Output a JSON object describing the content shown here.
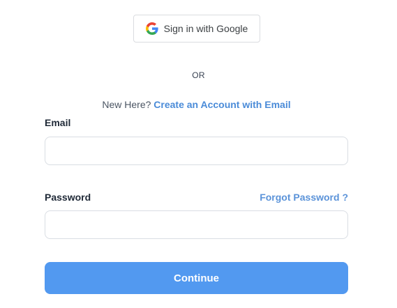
{
  "google_signin": {
    "label": "Sign in with Google",
    "icon": "google-g-icon"
  },
  "divider": {
    "text": "OR"
  },
  "signup_prompt": {
    "prefix": "New Here?",
    "link_text": "Create an Account with Email"
  },
  "form": {
    "email": {
      "label": "Email",
      "value": "",
      "placeholder": ""
    },
    "password": {
      "label": "Password",
      "value": "",
      "placeholder": "",
      "forgot_link": "Forgot Password ?"
    },
    "submit_label": "Continue"
  },
  "colors": {
    "primary_button": "#5299f0",
    "link": "#4a8bd8",
    "input_border": "#d9dde3"
  }
}
